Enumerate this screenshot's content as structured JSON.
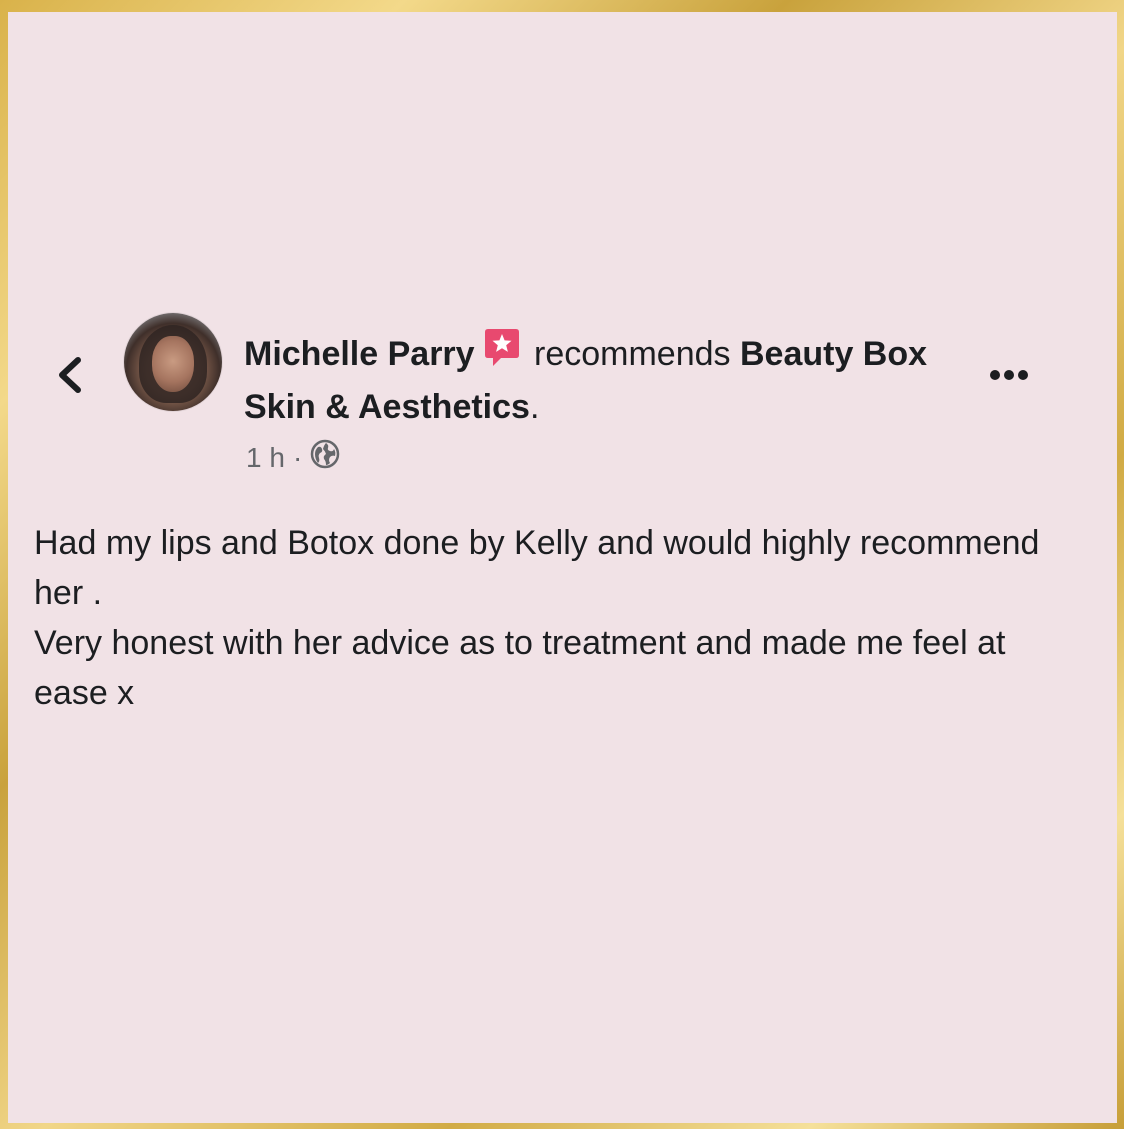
{
  "post": {
    "author": "Michelle Parry",
    "recommends_text": "recommends",
    "page_name": "Beauty Box Skin & Aesthetics",
    "page_name_suffix": ".",
    "time": "1 h",
    "separator": "·",
    "audience_icon": "globe-icon",
    "body_lines": [
      "Had my lips and Botox done by Kelly and would highly recommend her .",
      "Very honest with  her advice as to treatment and made me feel at ease x"
    ]
  },
  "icons": {
    "back": "chevron-left-icon",
    "recommend": "recommend-star-icon",
    "more": "more-dots-icon"
  },
  "colors": {
    "card_background": "#f1e2e6",
    "frame_gold": "#d9b24a",
    "text_primary": "#1c1e21",
    "text_secondary": "#65676b",
    "recommend_icon": "#e8496f"
  }
}
